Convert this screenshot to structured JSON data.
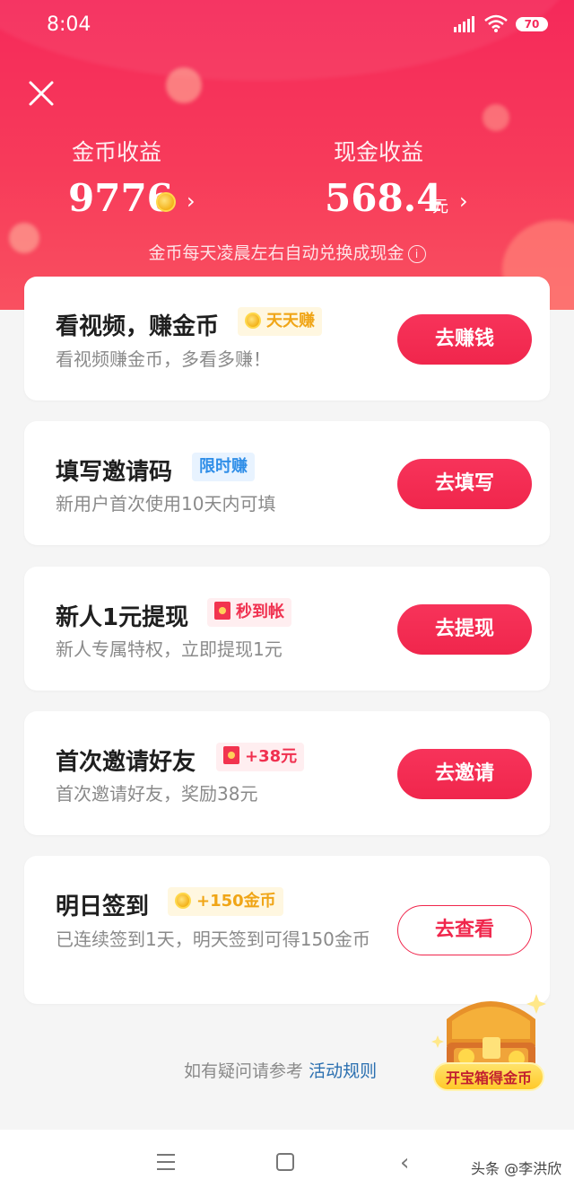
{
  "status": {
    "time": "8:04",
    "battery": "70"
  },
  "header": {
    "coin_label": "金币收益",
    "coin_value": "9776",
    "cash_label": "现金收益",
    "cash_value": "568.4",
    "cash_unit": "元",
    "note": "金币每天凌晨左右自动兑换成现金",
    "info_icon": "i"
  },
  "tasks": [
    {
      "title": "看视频，赚金币",
      "tag": "天天赚",
      "tag_icon": "coin-icon",
      "subtitle": "看视频赚金币，多看多赚！",
      "button": "去赚钱"
    },
    {
      "title": "填写邀请码",
      "tag": "限时赚",
      "subtitle": "新用户首次使用10天内可填",
      "button": "去填写"
    },
    {
      "title": "新人1元提现",
      "tag": "秒到帐",
      "tag_icon": "red-envelope-icon",
      "subtitle": "新人专属特权，立即提现1元",
      "button": "去提现"
    },
    {
      "title": "首次邀请好友",
      "tag": "+38元",
      "tag_icon": "red-envelope-icon",
      "subtitle": "首次邀请好友，奖励38元",
      "button": "去邀请"
    },
    {
      "title": "明日签到",
      "tag": "+150金币",
      "tag_icon": "coin-icon",
      "subtitle": "已连续签到1天，明天签到可得150金币",
      "button": "去查看"
    }
  ],
  "footer": {
    "text": "如有疑问请参考",
    "link": "活动规则"
  },
  "treasure": {
    "label": "开宝箱得金币"
  },
  "watermark": "头条 @李洪欣",
  "colors": {
    "accent": "#f0264c",
    "header": "#f5295a"
  }
}
